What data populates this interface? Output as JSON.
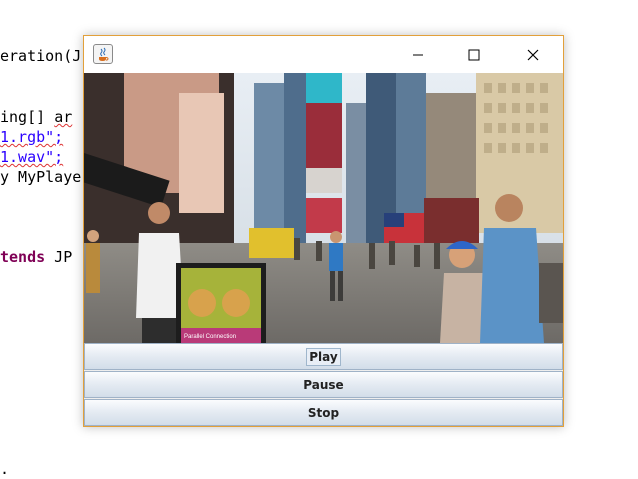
{
  "editor": {
    "line1": "eration(J",
    "line2_a": "ing[] ",
    "line2_b": "ar",
    "line3_a": "",
    "line3_str": "1.rgb\";",
    "line4_str": "1.wav\";",
    "line5": "y MyPlaye",
    "line6_kw": "tends",
    "line6_rest": " JP",
    "line7": "."
  },
  "window": {
    "title": "",
    "controls": {
      "play_label": "Play",
      "pause_label": "Pause",
      "stop_label": "Stop"
    }
  },
  "video": {
    "sign_text": "Parallel Connection"
  },
  "colors": {
    "window_border": "#e2a03a",
    "button_top": "#fbfcfe",
    "button_bottom": "#d2dde9"
  }
}
